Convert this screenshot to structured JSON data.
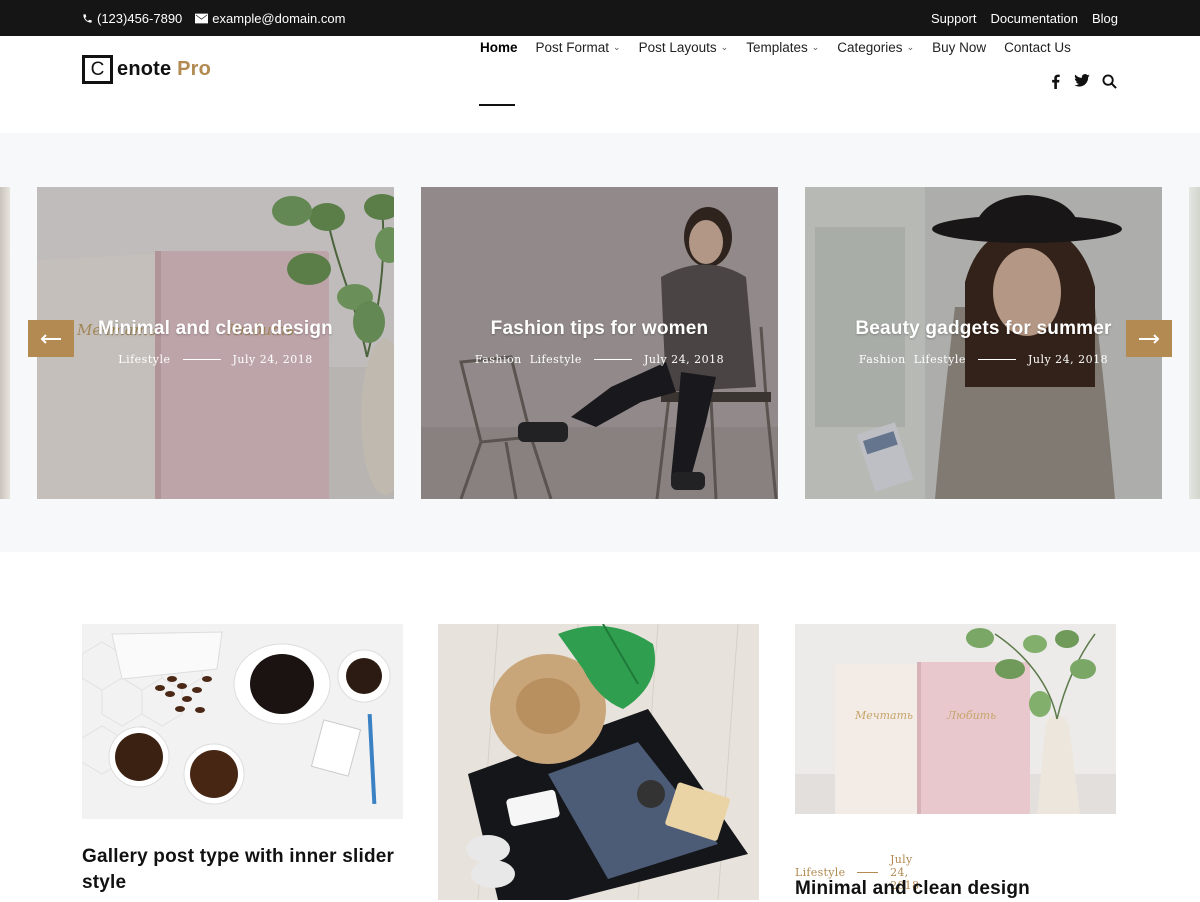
{
  "topbar": {
    "phone": "(123)456-7890",
    "email": "example@domain.com",
    "links": [
      "Support",
      "Documentation",
      "Blog"
    ]
  },
  "logo": {
    "letter": "C",
    "text": "enote",
    "pro": "Pro"
  },
  "nav": {
    "items": [
      {
        "label": "Home",
        "active": true,
        "dropdown": false
      },
      {
        "label": "Post Format",
        "dropdown": true
      },
      {
        "label": "Post Layouts",
        "dropdown": true
      },
      {
        "label": "Templates",
        "dropdown": true
      },
      {
        "label": "Categories",
        "dropdown": true
      },
      {
        "label": "Buy Now",
        "dropdown": false
      },
      {
        "label": "Contact Us",
        "dropdown": false
      }
    ],
    "icons": [
      "facebook-icon",
      "twitter-icon",
      "search-icon"
    ]
  },
  "slider": {
    "slides": [
      {
        "title": "Minimal and clean design",
        "categories": [
          "Lifestyle"
        ],
        "date": "July 24, 2018"
      },
      {
        "title": "Fashion tips for women",
        "categories": [
          "Fashion",
          "Lifestyle"
        ],
        "date": "July 24, 2018"
      },
      {
        "title": "Beauty gadgets for summer",
        "categories": [
          "Fashion",
          "Lifestyle"
        ],
        "date": "July 24, 2018"
      }
    ],
    "prev_icon": "arrow-left-icon",
    "next_icon": "arrow-right-icon"
  },
  "posts": [
    {
      "title": "Gallery post type with inner slider style"
    },
    {
      "title": ""
    },
    {
      "title": "Minimal and clean design",
      "category": "Lifestyle",
      "date": "July 24, 2018"
    }
  ],
  "colors": {
    "accent": "#b28a52",
    "topbar": "#151515",
    "hero_bg": "#f7f8fa"
  }
}
